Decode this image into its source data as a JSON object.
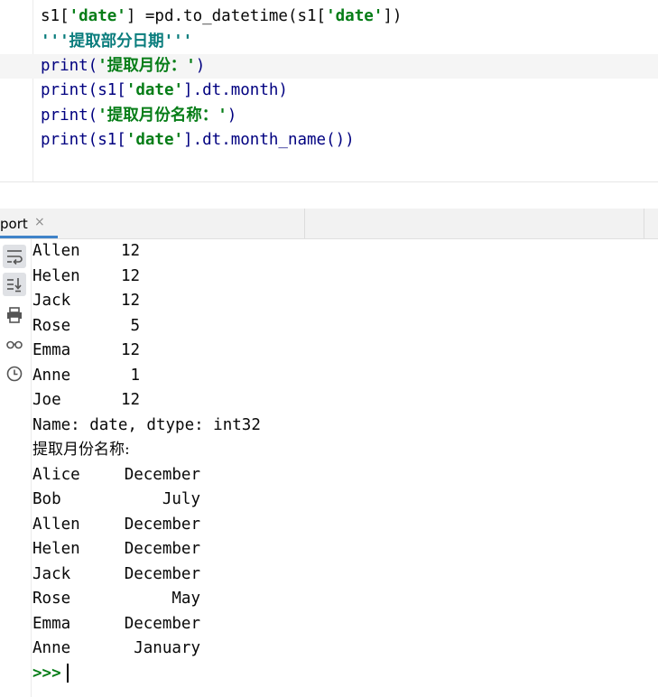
{
  "editor": {
    "lines": [
      [
        "s1[",
        "'date'",
        "] =pd.to_datetime(s1[",
        "'date'",
        "])"
      ],
      [
        "'''提取部分日期'''"
      ],
      [
        "print(",
        "'提取月份：'",
        ")"
      ],
      [
        "print(s1[",
        "'date'",
        "].dt.month)"
      ],
      [
        "print(",
        "'提取月份名称：'",
        ")"
      ],
      [
        "print(s1[",
        "'date'",
        "].dt.month_name())"
      ]
    ]
  },
  "tool_window": {
    "tab_label": "port",
    "tab_close": "×",
    "active_color": "#4083c9"
  },
  "toolbar": {
    "icons": [
      "soft-wrap-icon",
      "scroll-to-end-icon",
      "print-icon",
      "glasses-icon",
      "clock-icon"
    ]
  },
  "console": {
    "month_rows": [
      [
        "Allen",
        "12"
      ],
      [
        "Helen",
        "12"
      ],
      [
        "Jack",
        "12"
      ],
      [
        "Rose",
        " 5"
      ],
      [
        "Emma",
        "12"
      ],
      [
        "Anne",
        " 1"
      ],
      [
        "Joe",
        "12"
      ]
    ],
    "dtype_line": "Name: date, dtype: int32",
    "month_name_header": "提取月份名称:",
    "month_name_rows": [
      [
        "Alice",
        "December"
      ],
      [
        "Bob",
        "July"
      ],
      [
        "Allen",
        "December"
      ],
      [
        "Helen",
        "December"
      ],
      [
        "Jack",
        "December"
      ],
      [
        "Rose",
        "May"
      ],
      [
        "Emma",
        "December"
      ],
      [
        "Anne",
        "January"
      ]
    ],
    "prompt": ">>>"
  }
}
